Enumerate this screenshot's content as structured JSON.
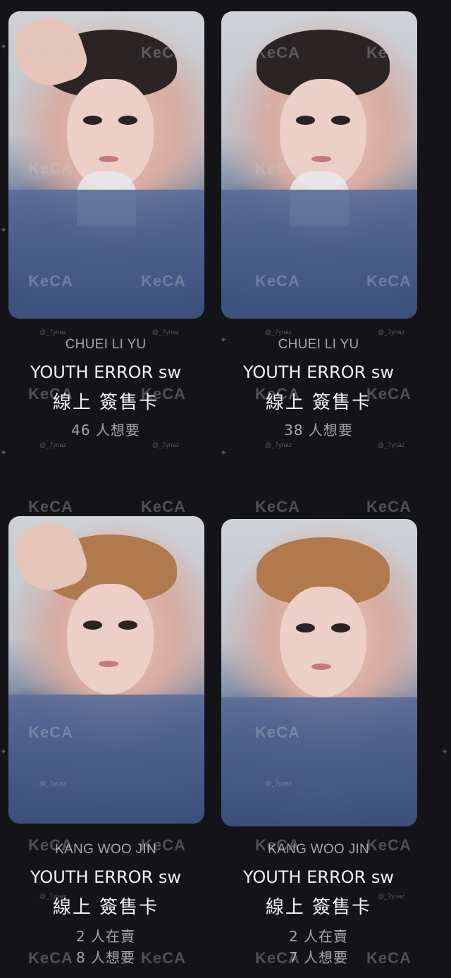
{
  "watermark": {
    "brand": "KeCA",
    "handle": "@_7ynaz"
  },
  "cards": [
    {
      "member": "CHUEI LI YU",
      "album": "YOUTH ERROR sw",
      "version": "線上 簽售卡",
      "stats": [
        "46 人想要"
      ]
    },
    {
      "member": "CHUEI LI YU",
      "album": "YOUTH ERROR sw",
      "version": "線上 簽售卡",
      "stats": [
        "38 人想要"
      ]
    },
    {
      "member": "KANG WOO JIN",
      "album": "YOUTH ERROR sw",
      "version": "線上 簽售卡",
      "stats": [
        "2 人在賣",
        "8 人想要"
      ]
    },
    {
      "member": "KANG WOO JIN",
      "album": "YOUTH ERROR sw",
      "version": "線上 簽售卡",
      "stats": [
        "2 人在賣",
        "7 人想要"
      ]
    }
  ],
  "colors": {
    "background": "#141418",
    "primary_text": "#f2f2f5",
    "secondary_text": "#a3a5b0"
  }
}
